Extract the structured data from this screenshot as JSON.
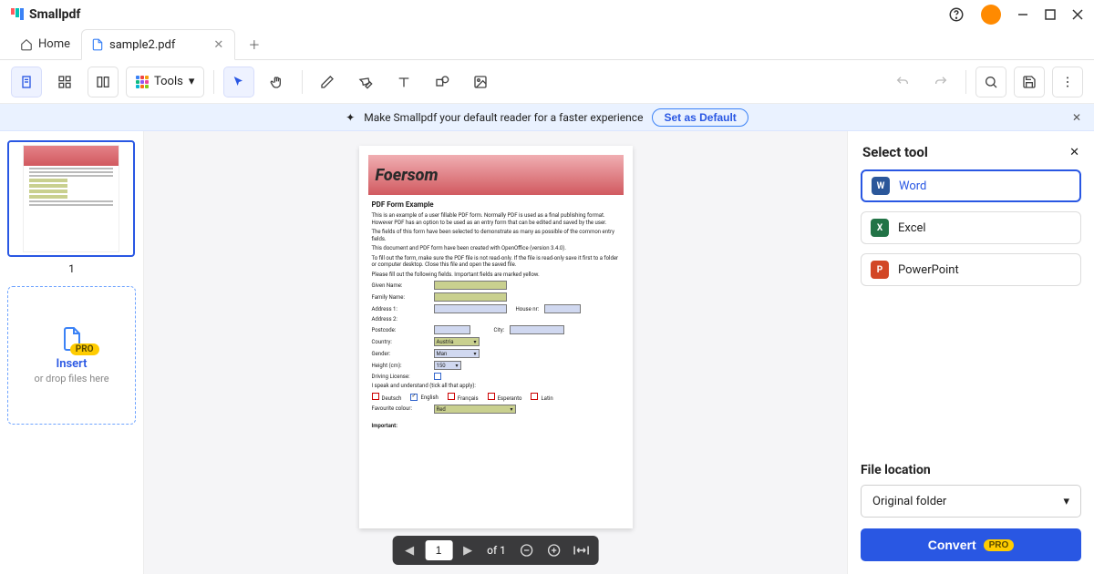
{
  "app": {
    "brand": "Smallpdf"
  },
  "tabs": {
    "home": "Home",
    "file": "sample2.pdf"
  },
  "toolbar": {
    "tools_label": "Tools"
  },
  "banner": {
    "text": "Make Smallpdf your default reader for a faster experience",
    "button": "Set as Default"
  },
  "thumb": {
    "page": "1"
  },
  "insert": {
    "pro": "PRO",
    "label": "Insert",
    "hint": "or drop files here"
  },
  "doc": {
    "brand": "Foersom",
    "h1": "PDF Form Example",
    "p1": "This is an example of a user fillable PDF form. Normally PDF is used as a final publishing format. However PDF has an option to be used as an entry form that can be edited and saved by the user.",
    "p2": "The fields of this form have been selected to demonstrate as many as possible of the common entry fields.",
    "p3": "This document and PDF form have been created with OpenOffice (version 3.4.0).",
    "p4": "To fill out the form, make sure the PDF file is not read-only. If the file is read-only save it first to a folder or computer desktop. Close this file and open the saved file.",
    "p5": "Please fill out the following fields. Important fields are marked yellow.",
    "given": "Given Name:",
    "family": "Family Name:",
    "addr1": "Address 1:",
    "houseno": "House nr:",
    "addr2": "Address 2:",
    "postcode": "Postcode:",
    "city": "City:",
    "country": "Country:",
    "country_val": "Austria",
    "gender": "Gender:",
    "gender_val": "Man",
    "height": "Height (cm):",
    "height_val": "150",
    "license": "Driving License:",
    "speak": "I speak and understand (tick all that apply):",
    "lang_de": "Deutsch",
    "lang_en": "English",
    "lang_fr": "Français",
    "lang_eo": "Esperanto",
    "lang_la": "Latin",
    "favcol": "Favourite colour:",
    "favcol_val": "Red",
    "important": "Important:"
  },
  "pager": {
    "current": "1",
    "of": "of 1"
  },
  "panel": {
    "title": "Select tool",
    "word": "Word",
    "excel": "Excel",
    "ppt": "PowerPoint",
    "file_location": "File location",
    "folder": "Original folder",
    "convert": "Convert",
    "pro": "PRO"
  }
}
